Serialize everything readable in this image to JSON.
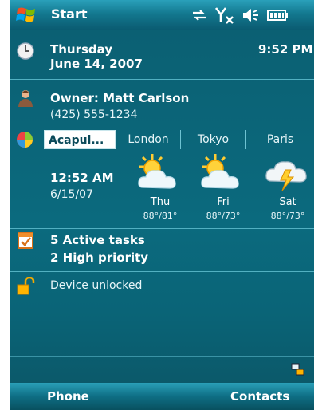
{
  "titlebar": {
    "title": "Start"
  },
  "datetime": {
    "day": "Thursday",
    "date": "June 14, 2007",
    "time": "9:52 PM"
  },
  "owner": {
    "name_line": "Owner: Matt Carlson",
    "phone": "(425) 555-1234"
  },
  "weather": {
    "tabs": [
      {
        "label": "Acapul...",
        "active": true
      },
      {
        "label": "London",
        "active": false
      },
      {
        "label": "Tokyo",
        "active": false
      },
      {
        "label": "Paris",
        "active": false
      }
    ],
    "current_time": "12:52 AM",
    "current_date": "6/15/07",
    "forecast": [
      {
        "day": "Thu",
        "temps": "88°/81°",
        "icon": "partly-sunny-icon"
      },
      {
        "day": "Fri",
        "temps": "88°/73°",
        "icon": "partly-sunny-icon"
      },
      {
        "day": "Sat",
        "temps": "88°/73°",
        "icon": "thunderstorm-icon"
      }
    ]
  },
  "tasks": {
    "line1": "5 Active tasks",
    "line2": "2 High priority"
  },
  "device": {
    "status": "Device unlocked"
  },
  "softkeys": {
    "left": "Phone",
    "right": "Contacts"
  },
  "colors": {
    "background": "#0b6073",
    "bar_accent": "#2aa0ba"
  }
}
